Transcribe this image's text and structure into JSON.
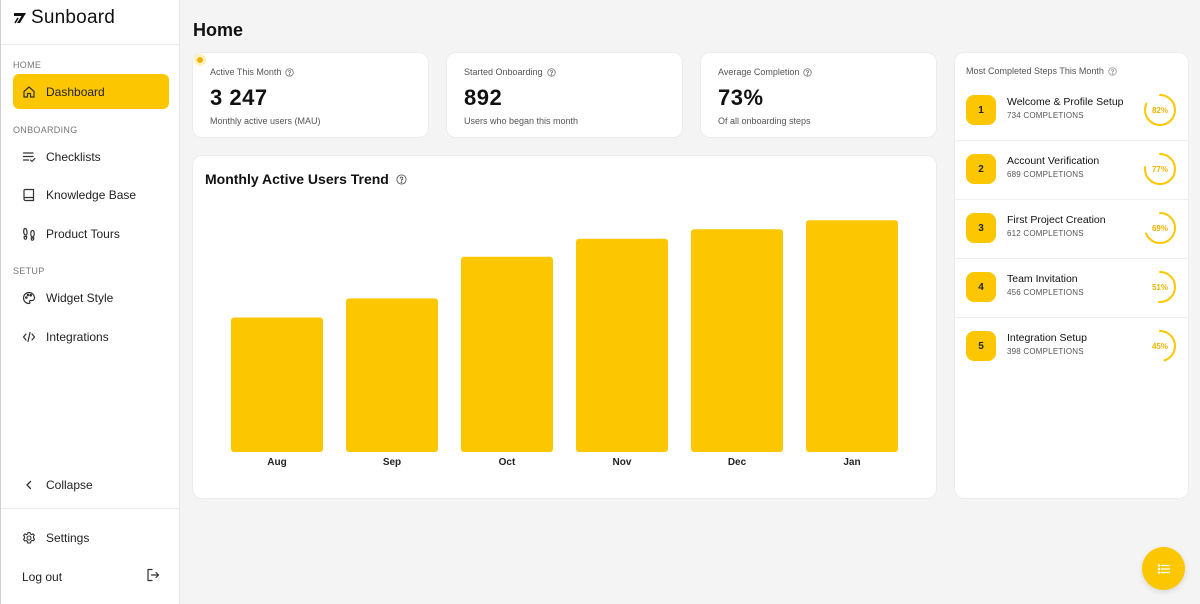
{
  "app": {
    "name": "Sunboard"
  },
  "sidebar": {
    "sections": {
      "home": "HOME",
      "onboarding": "ONBOARDING",
      "setup": "SETUP"
    },
    "items": [
      {
        "label": "Dashboard",
        "icon": "home-icon",
        "active": true
      },
      {
        "label": "Checklists",
        "icon": "checklist-icon",
        "active": false
      },
      {
        "label": "Knowledge Base",
        "icon": "book-icon",
        "active": false
      },
      {
        "label": "Product Tours",
        "icon": "footprints-icon",
        "active": false
      },
      {
        "label": "Widget Style",
        "icon": "palette-icon",
        "active": false
      },
      {
        "label": "Integrations",
        "icon": "code-icon",
        "active": false
      }
    ],
    "collapse_label": "Collapse",
    "settings_label": "Settings",
    "logout_label": "Log out"
  },
  "page": {
    "title": "Home"
  },
  "stats": [
    {
      "label": "Active This Month",
      "value": "3 247",
      "sub": "Monthly active users (MAU)"
    },
    {
      "label": "Started Onboarding",
      "value": "892",
      "sub": "Users who began this month"
    },
    {
      "label": "Average Completion",
      "value": "73%",
      "sub": "Of all onboarding steps"
    }
  ],
  "chart": {
    "title": "Monthly Active Users Trend"
  },
  "chart_data": {
    "type": "bar",
    "title": "Monthly Active Users Trend",
    "categories": [
      "Aug",
      "Sep",
      "Oct",
      "Nov",
      "Dec",
      "Jan"
    ],
    "values": [
      2100,
      2400,
      3050,
      3330,
      3480,
      3620
    ],
    "xlabel": "",
    "ylabel": "",
    "ylim": [
      0,
      3780
    ],
    "grid": false,
    "legend": "none",
    "color": "#fcc700"
  },
  "steps": {
    "title": "Most Completed Steps This Month",
    "items": [
      {
        "num": "1",
        "name": "Welcome & Profile Setup",
        "count": "734 COMPLETIONS",
        "pct": "82%",
        "fraction": 0.82
      },
      {
        "num": "2",
        "name": "Account Verification",
        "count": "689 COMPLETIONS",
        "pct": "77%",
        "fraction": 0.77
      },
      {
        "num": "3",
        "name": "First Project Creation",
        "count": "612 COMPLETIONS",
        "pct": "69%",
        "fraction": 0.69
      },
      {
        "num": "4",
        "name": "Team Invitation",
        "count": "456 COMPLETIONS",
        "pct": "51%",
        "fraction": 0.51
      },
      {
        "num": "5",
        "name": "Integration Setup",
        "count": "398 COMPLETIONS",
        "pct": "45%",
        "fraction": 0.45
      }
    ]
  },
  "colors": {
    "accent": "#fcc700",
    "accent_text": "#f0b400"
  },
  "fab": {
    "icon": "list-icon"
  }
}
